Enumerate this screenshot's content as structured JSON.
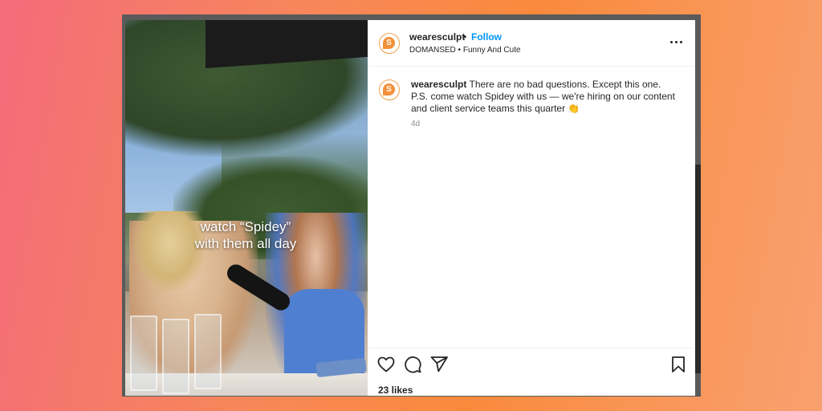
{
  "post": {
    "username": "wearesculpt",
    "separator": "•",
    "follow_label": "Follow",
    "audio": "DOMANSED • Funny And Cute",
    "avatar_letter": "S",
    "video_caption_line1": "watch “Spidey”",
    "video_caption_line2": "with them all day",
    "caption_username": "wearesculpt",
    "caption_text": "There are no bad questions. Except this one. P.S. come watch Spidey with us — we're hiring on our content and client service teams this quarter 👏",
    "age": "4d",
    "likes": "23 likes"
  },
  "icons": {
    "like": "heart-icon",
    "comment": "comment-icon",
    "share": "send-icon",
    "save": "bookmark-icon",
    "more": "more-options-icon"
  },
  "colors": {
    "brand": "#f4903a",
    "follow": "#0095f6",
    "text": "#262626",
    "muted": "#8e8e8e"
  }
}
